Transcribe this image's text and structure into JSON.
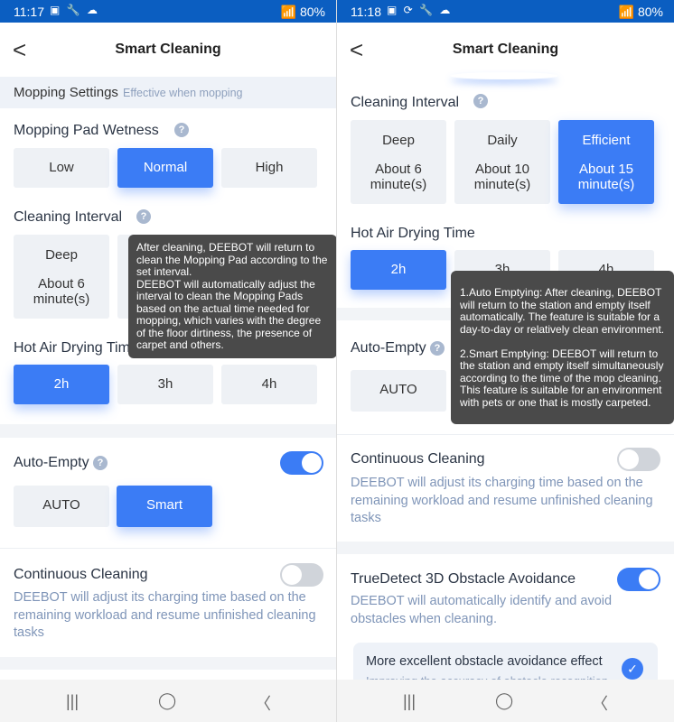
{
  "left": {
    "status": {
      "time": "11:17",
      "icons": "▣ 🔧 ☁",
      "battery": "80%"
    },
    "header": {
      "title": "Smart Cleaning"
    },
    "mopping": {
      "title": "Mopping Settings",
      "subtitle": "Effective when mopping"
    },
    "wetness": {
      "label": "Mopping Pad Wetness",
      "options": [
        "Low",
        "Normal",
        "High"
      ],
      "selected": "Normal"
    },
    "interval": {
      "label": "Cleaning Interval",
      "card": {
        "name": "Deep",
        "time": "About 6 minute(s)"
      }
    },
    "interval_tooltip": "After cleaning, DEEBOT will return to clean the Mopping Pad according to the set interval.\nDEEBOT will automatically adjust the interval to clean the Mopping Pads based on the actual time needed for mopping, which varies with the degree of the floor dirtiness, the presence of carpet and others.",
    "drying": {
      "label": "Hot Air Drying Tim",
      "options": [
        "2h",
        "3h",
        "4h"
      ],
      "selected": "2h"
    },
    "auto_empty": {
      "label": "Auto-Empty",
      "enabled": true,
      "options": [
        "AUTO",
        "Smart"
      ],
      "selected": "Smart"
    },
    "continuous": {
      "label": "Continuous Cleaning",
      "enabled": false,
      "desc": "DEEBOT will adjust its charging time based on the remaining workload and resume unfinished cleaning tasks"
    }
  },
  "right": {
    "status": {
      "time": "11:18",
      "icons": "▣ ⟳ 🔧 ☁",
      "battery": "80%"
    },
    "header": {
      "title": "Smart Cleaning"
    },
    "interval": {
      "label": "Cleaning Interval",
      "cards": [
        {
          "name": "Deep",
          "time": "About 6 minute(s)"
        },
        {
          "name": "Daily",
          "time": "About 10 minute(s)"
        },
        {
          "name": "Efficient",
          "time": "About 15 minute(s)"
        }
      ],
      "selected": "Efficient"
    },
    "drying": {
      "label": "Hot Air Drying Time",
      "options": [
        "2h",
        "3h",
        "4h"
      ],
      "selected": "2h"
    },
    "auto_empty": {
      "label": "Auto-Empty",
      "options": [
        "AUTO"
      ]
    },
    "auto_empty_tooltip": "1.Auto Emptying: After cleaning, DEEBOT will return to the station and empty itself automatically. The feature is suitable for a day-to-day or relatively clean environment.\n\n2.Smart Emptying: DEEBOT will return to the station and empty itself simultaneously according to the time of the mop cleaning. This feature is suitable for an environment with pets or one that is mostly carpeted.",
    "continuous": {
      "label": "Continuous Cleaning",
      "enabled": false,
      "desc": "DEEBOT will adjust its charging time based on the remaining workload and resume unfinished cleaning tasks"
    },
    "truedetect": {
      "label": "TrueDetect 3D Obstacle Avoidance",
      "enabled": true,
      "desc": "DEEBOT will automatically identify and avoid obstacles when cleaning.",
      "option": {
        "title": "More excellent obstacle avoidance effect",
        "subtitle": "Improving the accuracy of obstacle recognition",
        "checked": true
      }
    }
  },
  "nav": {
    "recent": "|||",
    "home": "◯",
    "back": "〈"
  },
  "colors": {
    "accent": "#3b7cf5",
    "status_bar": "#0b5ec1",
    "tooltip": "#4a4a4a"
  }
}
